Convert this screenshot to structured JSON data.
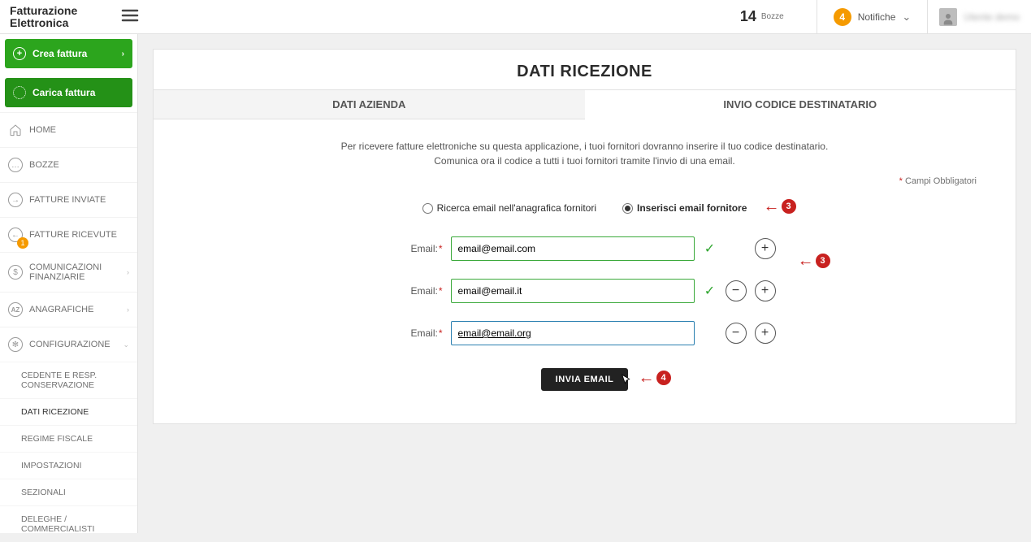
{
  "brand": "Fatturazione\nElettronica",
  "top": {
    "drafts_count": "14",
    "drafts_label": "Bozze",
    "notif_count": "4",
    "notif_label": "Notifiche",
    "username": "Utente demo"
  },
  "sidebar": {
    "create": "Crea fattura",
    "upload": "Carica fattura",
    "items": [
      {
        "label": "HOME"
      },
      {
        "label": "BOZZE"
      },
      {
        "label": "FATTURE INVIATE"
      },
      {
        "label": "FATTURE RICEVUTE",
        "badge": "1"
      },
      {
        "label": "COMUNICAZIONI FINANZIARIE",
        "ar": true
      },
      {
        "label": "ANAGRAFICHE",
        "ar": true,
        "az": true
      },
      {
        "label": "CONFIGURAZIONE",
        "ar": true,
        "open": true,
        "gear": true
      }
    ],
    "config_sub": [
      "CEDENTE E RESP. CONSERVAZIONE",
      "DATI RICEZIONE",
      "REGIME FISCALE",
      "IMPOSTAZIONI",
      "SEZIONALI",
      "DELEGHE / COMMERCIALISTI"
    ]
  },
  "panel": {
    "title": "DATI RICEZIONE",
    "tab1": "DATI AZIENDA",
    "tab2": "INVIO CODICE DESTINATARIO",
    "info1": "Per ricevere fatture elettroniche su questa applicazione, i tuoi fornitori dovranno inserire il tuo codice destinatario.",
    "info2": "Comunica ora il codice a tutti i tuoi fornitori tramite l'invio di una email.",
    "required": "Campi Obbligatori",
    "radio1": "Ricerca email nell'anagrafica fornitori",
    "radio2": "Inserisci email fornitore",
    "email_label": "Email:",
    "emails": [
      {
        "value": "email@email.com",
        "valid": true,
        "remove": false,
        "add": true
      },
      {
        "value": "email@email.it",
        "valid": true,
        "remove": true,
        "add": true
      },
      {
        "value": "email@email.org",
        "valid": false,
        "remove": true,
        "add": true,
        "focus": true
      }
    ],
    "send": "INVIA EMAIL"
  },
  "annotations": {
    "a": "3",
    "b": "3",
    "c": "4"
  }
}
